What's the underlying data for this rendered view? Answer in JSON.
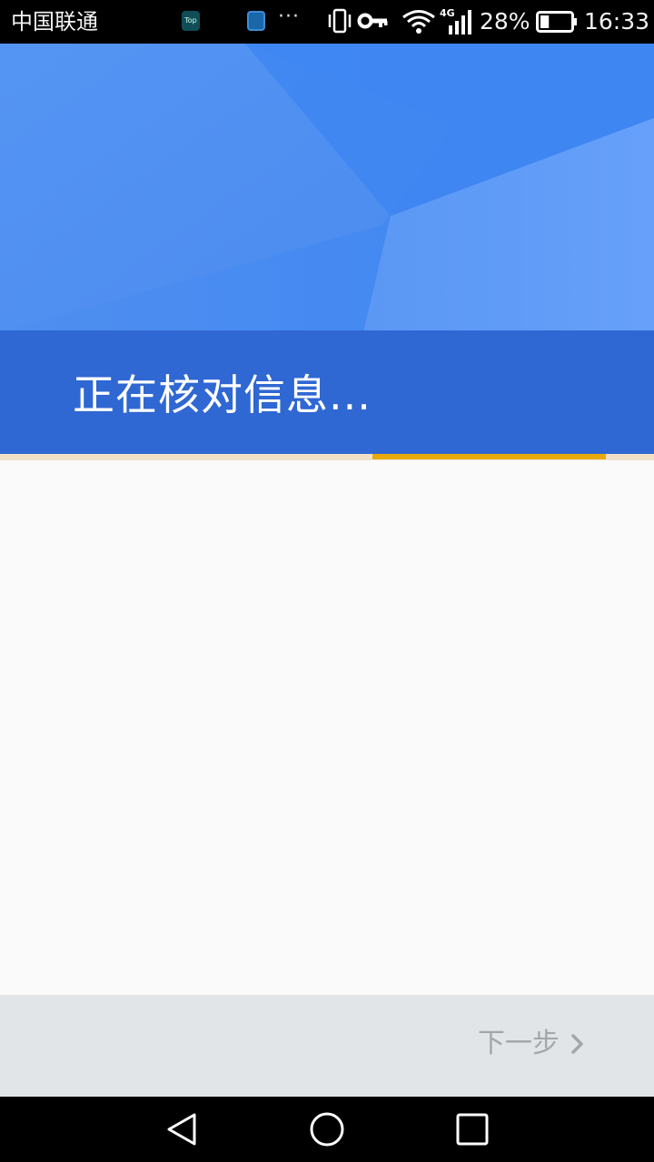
{
  "status_bar": {
    "carrier": "中国联通",
    "notification_icons": [
      "top-app-icon",
      "document-app-icon"
    ],
    "overflow": "···",
    "network_type": "4G",
    "battery_percent": "28%",
    "battery_level": 0.28,
    "time": "16:33"
  },
  "header": {
    "title": "正在核对信息..."
  },
  "progress": {
    "fraction_start": 0.57,
    "fraction_end": 0.926
  },
  "footer": {
    "next_label": "下一步"
  },
  "colors": {
    "header_top": "#4a86ee",
    "header_band": "#2f67d3",
    "progress_accent": "#e8a90c",
    "footer_bg": "#e2e5e8",
    "next_text": "#a4a7aa"
  }
}
